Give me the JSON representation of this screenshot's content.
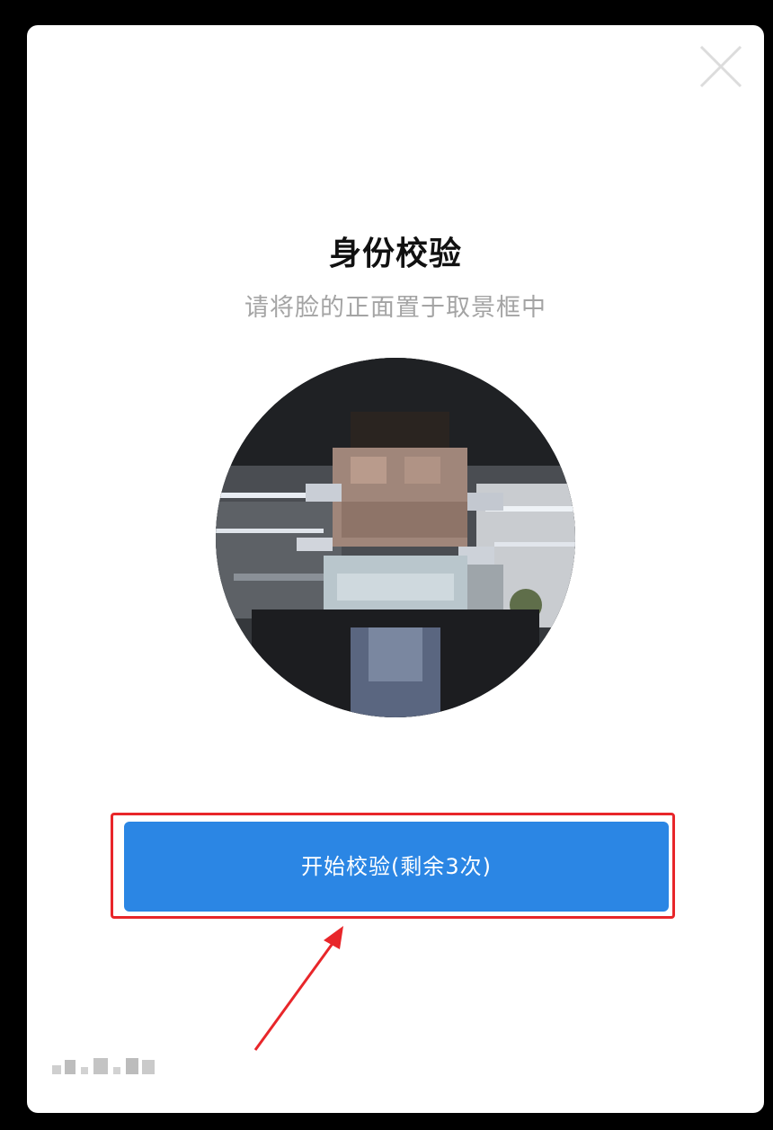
{
  "dialog": {
    "title": "身份校验",
    "subtitle": "请将脸的正面置于取景框中",
    "close_icon": "close-icon",
    "camera_preview": "face-camera-preview",
    "start_button": {
      "label": "开始校验(剩余3次)",
      "remaining_attempts": 3
    }
  },
  "annotation": {
    "highlight_color": "#e8262a",
    "arrow_icon": "red-arrow-icon"
  },
  "colors": {
    "button": "#2b86e4",
    "background": "#000000",
    "dialog": "#ffffff"
  }
}
